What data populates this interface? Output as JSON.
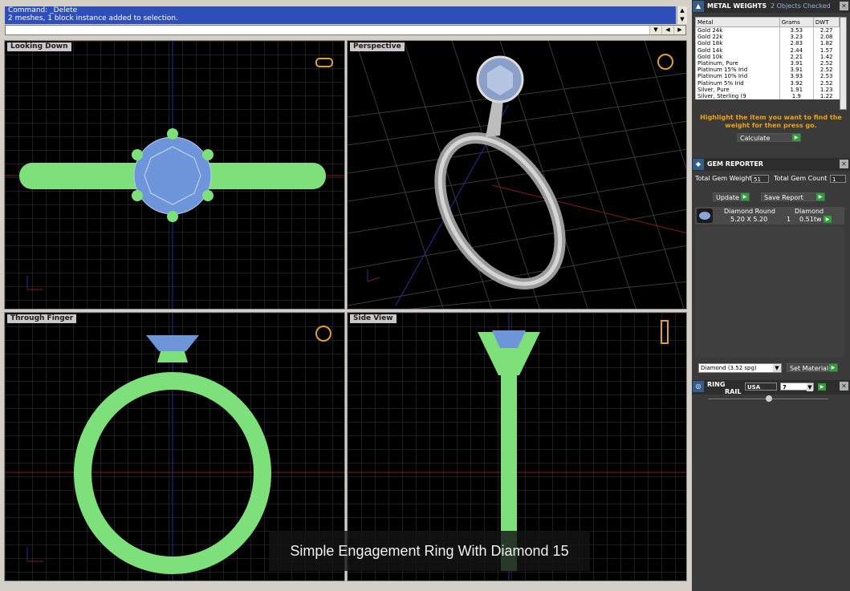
{
  "command": {
    "history": [
      "Command: _Delete",
      "2 meshes, 1 block instance added to selection."
    ],
    "prompt_label": "Command:",
    "value": ""
  },
  "viewports": {
    "top": "Looking Down",
    "perspective": "Perspective",
    "front": "Through Finger",
    "right": "Side View"
  },
  "caption": "Simple Engagement Ring With Diamond 15",
  "metal_weights": {
    "title": "METAL WEIGHTS",
    "status": "2 Objects Checked",
    "columns": [
      "Metal",
      "Grams",
      "DWT"
    ],
    "rows": [
      [
        "Gold 24k",
        "3.53",
        "2.27"
      ],
      [
        "Gold 22k",
        "3.23",
        "2.08"
      ],
      [
        "Gold 18k",
        "2.83",
        "1.82"
      ],
      [
        "Gold 14k",
        "2.44",
        "1.57"
      ],
      [
        "Gold 10k",
        "2.21",
        "1.42"
      ],
      [
        "Platinum, Pure",
        "3.91",
        "2.52"
      ],
      [
        "Platinum 15% Irid",
        "3.91",
        "2.52"
      ],
      [
        "Platinum 10% Irid",
        "3.93",
        "2.53"
      ],
      [
        "Platinum 5% Irid",
        "3.92",
        "2.52"
      ],
      [
        "Silver, Pure",
        "1.91",
        "1.23"
      ],
      [
        "Silver, Sterling (9",
        "1.9",
        "1.22"
      ]
    ],
    "hint": "Highlight the item you want to find the weight for then press go.",
    "calculate": "Calculate"
  },
  "gem_reporter": {
    "title": "GEM REPORTER",
    "total_weight_label": "Total Gem Weight",
    "total_weight": "51",
    "total_count_label": "Total Gem Count",
    "total_count": "1",
    "update": "Update",
    "save_report": "Save Report",
    "gem": {
      "name": "Diamond Round",
      "material": "Diamond",
      "size": "5.20 X 5.20",
      "qty": "1",
      "weight": "0.51tw"
    },
    "material_select": "Diamond   (3.52 spg)",
    "set_material": "Set Material"
  },
  "ring_rail": {
    "title_line1": "RING",
    "title_line2": "RAIL",
    "standard": "USA",
    "size": "7"
  }
}
